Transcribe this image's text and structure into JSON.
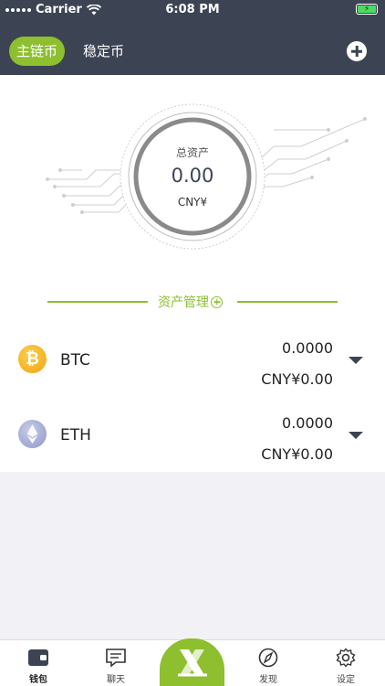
{
  "status_bar": {
    "carrier": "Carrier",
    "time": "6:08 PM"
  },
  "header": {
    "tabs": [
      {
        "label": "主链币",
        "active": true
      },
      {
        "label": "稳定币",
        "active": false
      }
    ],
    "add_icon": "plus-circle-icon"
  },
  "hero": {
    "total_label": "总资产",
    "total_value": "0.00",
    "unit": "CNY¥"
  },
  "asset_management": {
    "label": "资产管理"
  },
  "assets": [
    {
      "symbol": "BTC",
      "amount": "0.0000",
      "value": "CNY¥0.00",
      "icon": "bitcoin-icon",
      "color": "#f3a313"
    },
    {
      "symbol": "ETH",
      "amount": "0.0000",
      "value": "CNY¥0.00",
      "icon": "ethereum-icon",
      "color": "#8f98c9"
    }
  ],
  "tabbar": {
    "items": [
      {
        "label": "钱包",
        "icon": "wallet-icon",
        "active": true
      },
      {
        "label": "聊天",
        "icon": "chat-icon",
        "active": false
      },
      {
        "label": "",
        "icon": "x-logo-icon",
        "active": false
      },
      {
        "label": "发现",
        "icon": "compass-icon",
        "active": false
      },
      {
        "label": "设定",
        "icon": "gear-icon",
        "active": false
      }
    ]
  },
  "colors": {
    "header_bg": "#3c4454",
    "accent": "#8dbf2f",
    "page_bg": "#f2f2f6"
  }
}
